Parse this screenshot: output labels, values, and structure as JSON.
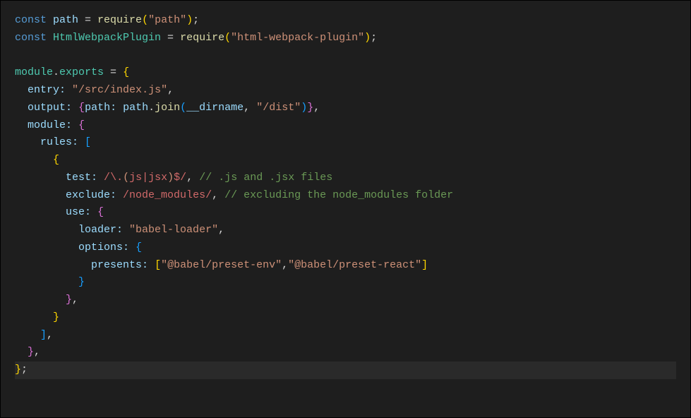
{
  "code": {
    "lines": [
      {
        "tokens": [
          {
            "t": "const ",
            "c": "kw-storage"
          },
          {
            "t": "path",
            "c": "variable"
          },
          {
            "t": " = ",
            "c": "op"
          },
          {
            "t": "require",
            "c": "func-call"
          },
          {
            "t": "(",
            "c": "brace-yellow"
          },
          {
            "t": "\"path\"",
            "c": "string"
          },
          {
            "t": ")",
            "c": "brace-yellow"
          },
          {
            "t": ";",
            "c": "semi"
          }
        ]
      },
      {
        "tokens": [
          {
            "t": "const ",
            "c": "kw-storage"
          },
          {
            "t": "HtmlWebpackPlugin",
            "c": "kw-module"
          },
          {
            "t": " = ",
            "c": "op"
          },
          {
            "t": "require",
            "c": "func-call"
          },
          {
            "t": "(",
            "c": "brace-yellow"
          },
          {
            "t": "\"html-webpack-plugin\"",
            "c": "string"
          },
          {
            "t": ")",
            "c": "brace-yellow"
          },
          {
            "t": ";",
            "c": "semi"
          }
        ]
      },
      {
        "tokens": [
          {
            "t": " ",
            "c": "whitespace"
          }
        ]
      },
      {
        "tokens": [
          {
            "t": "module",
            "c": "kw-module"
          },
          {
            "t": ".",
            "c": "op"
          },
          {
            "t": "exports",
            "c": "kw-module"
          },
          {
            "t": " = ",
            "c": "op"
          },
          {
            "t": "{",
            "c": "brace-yellow"
          }
        ]
      },
      {
        "tokens": [
          {
            "t": "  ",
            "c": "whitespace"
          },
          {
            "t": "entry:",
            "c": "prop"
          },
          {
            "t": " ",
            "c": "whitespace"
          },
          {
            "t": "\"/src/index.js\"",
            "c": "string"
          },
          {
            "t": ",",
            "c": "semi"
          }
        ]
      },
      {
        "tokens": [
          {
            "t": "  ",
            "c": "whitespace"
          },
          {
            "t": "output:",
            "c": "prop"
          },
          {
            "t": " ",
            "c": "whitespace"
          },
          {
            "t": "{",
            "c": "brace-pink"
          },
          {
            "t": "path:",
            "c": "prop"
          },
          {
            "t": " ",
            "c": "whitespace"
          },
          {
            "t": "path",
            "c": "variable"
          },
          {
            "t": ".",
            "c": "op"
          },
          {
            "t": "join",
            "c": "func-call"
          },
          {
            "t": "(",
            "c": "brace-blue"
          },
          {
            "t": "__dirname",
            "c": "variable"
          },
          {
            "t": ", ",
            "c": "op"
          },
          {
            "t": "\"/dist\"",
            "c": "string"
          },
          {
            "t": ")",
            "c": "brace-blue"
          },
          {
            "t": "}",
            "c": "brace-pink"
          },
          {
            "t": ",",
            "c": "semi"
          }
        ]
      },
      {
        "tokens": [
          {
            "t": "  ",
            "c": "whitespace"
          },
          {
            "t": "module:",
            "c": "prop"
          },
          {
            "t": " ",
            "c": "whitespace"
          },
          {
            "t": "{",
            "c": "brace-pink"
          }
        ]
      },
      {
        "tokens": [
          {
            "t": "    ",
            "c": "whitespace"
          },
          {
            "t": "rules:",
            "c": "prop"
          },
          {
            "t": " ",
            "c": "whitespace"
          },
          {
            "t": "[",
            "c": "brace-blue"
          }
        ]
      },
      {
        "tokens": [
          {
            "t": "      ",
            "c": "whitespace"
          },
          {
            "t": "{",
            "c": "brace-yellow"
          }
        ]
      },
      {
        "tokens": [
          {
            "t": "        ",
            "c": "whitespace"
          },
          {
            "t": "test:",
            "c": "prop"
          },
          {
            "t": " ",
            "c": "whitespace"
          },
          {
            "t": "/",
            "c": "regex"
          },
          {
            "t": "\\.",
            "c": "regex"
          },
          {
            "t": "(",
            "c": "regex-class"
          },
          {
            "t": "js",
            "c": "regex"
          },
          {
            "t": "|",
            "c": "regex"
          },
          {
            "t": "jsx",
            "c": "regex"
          },
          {
            "t": ")",
            "c": "regex-class"
          },
          {
            "t": "$",
            "c": "regex"
          },
          {
            "t": "/",
            "c": "regex"
          },
          {
            "t": ", ",
            "c": "op"
          },
          {
            "t": "// .js and .jsx files",
            "c": "comment"
          }
        ]
      },
      {
        "tokens": [
          {
            "t": "        ",
            "c": "whitespace"
          },
          {
            "t": "exclude:",
            "c": "prop"
          },
          {
            "t": " ",
            "c": "whitespace"
          },
          {
            "t": "/node_modules/",
            "c": "regex"
          },
          {
            "t": ", ",
            "c": "op"
          },
          {
            "t": "// excluding the node_modules folder",
            "c": "comment"
          }
        ]
      },
      {
        "tokens": [
          {
            "t": "        ",
            "c": "whitespace"
          },
          {
            "t": "use:",
            "c": "prop"
          },
          {
            "t": " ",
            "c": "whitespace"
          },
          {
            "t": "{",
            "c": "brace-pink"
          }
        ]
      },
      {
        "tokens": [
          {
            "t": "          ",
            "c": "whitespace"
          },
          {
            "t": "loader:",
            "c": "prop"
          },
          {
            "t": " ",
            "c": "whitespace"
          },
          {
            "t": "\"babel-loader\"",
            "c": "string"
          },
          {
            "t": ",",
            "c": "semi"
          }
        ]
      },
      {
        "tokens": [
          {
            "t": "          ",
            "c": "whitespace"
          },
          {
            "t": "options:",
            "c": "prop"
          },
          {
            "t": " ",
            "c": "whitespace"
          },
          {
            "t": "{",
            "c": "brace-blue"
          }
        ]
      },
      {
        "tokens": [
          {
            "t": "            ",
            "c": "whitespace"
          },
          {
            "t": "presents:",
            "c": "prop"
          },
          {
            "t": " ",
            "c": "whitespace"
          },
          {
            "t": "[",
            "c": "brace-yellow"
          },
          {
            "t": "\"@babel/preset-env\"",
            "c": "string"
          },
          {
            "t": ",",
            "c": "op"
          },
          {
            "t": "\"@babel/preset-react\"",
            "c": "string"
          },
          {
            "t": "]",
            "c": "brace-yellow"
          }
        ]
      },
      {
        "tokens": [
          {
            "t": "          ",
            "c": "whitespace"
          },
          {
            "t": "}",
            "c": "brace-blue"
          }
        ]
      },
      {
        "tokens": [
          {
            "t": "        ",
            "c": "whitespace"
          },
          {
            "t": "}",
            "c": "brace-pink"
          },
          {
            "t": ",",
            "c": "semi"
          }
        ]
      },
      {
        "tokens": [
          {
            "t": "      ",
            "c": "whitespace"
          },
          {
            "t": "}",
            "c": "brace-yellow"
          }
        ]
      },
      {
        "tokens": [
          {
            "t": "    ",
            "c": "whitespace"
          },
          {
            "t": "]",
            "c": "brace-blue"
          },
          {
            "t": ",",
            "c": "semi"
          }
        ]
      },
      {
        "tokens": [
          {
            "t": "  ",
            "c": "whitespace"
          },
          {
            "t": "}",
            "c": "brace-pink"
          },
          {
            "t": ",",
            "c": "semi"
          }
        ]
      },
      {
        "tokens": [
          {
            "t": "}",
            "c": "brace-yellow"
          },
          {
            "t": ";",
            "c": "semi"
          }
        ],
        "highlight": true
      }
    ]
  }
}
